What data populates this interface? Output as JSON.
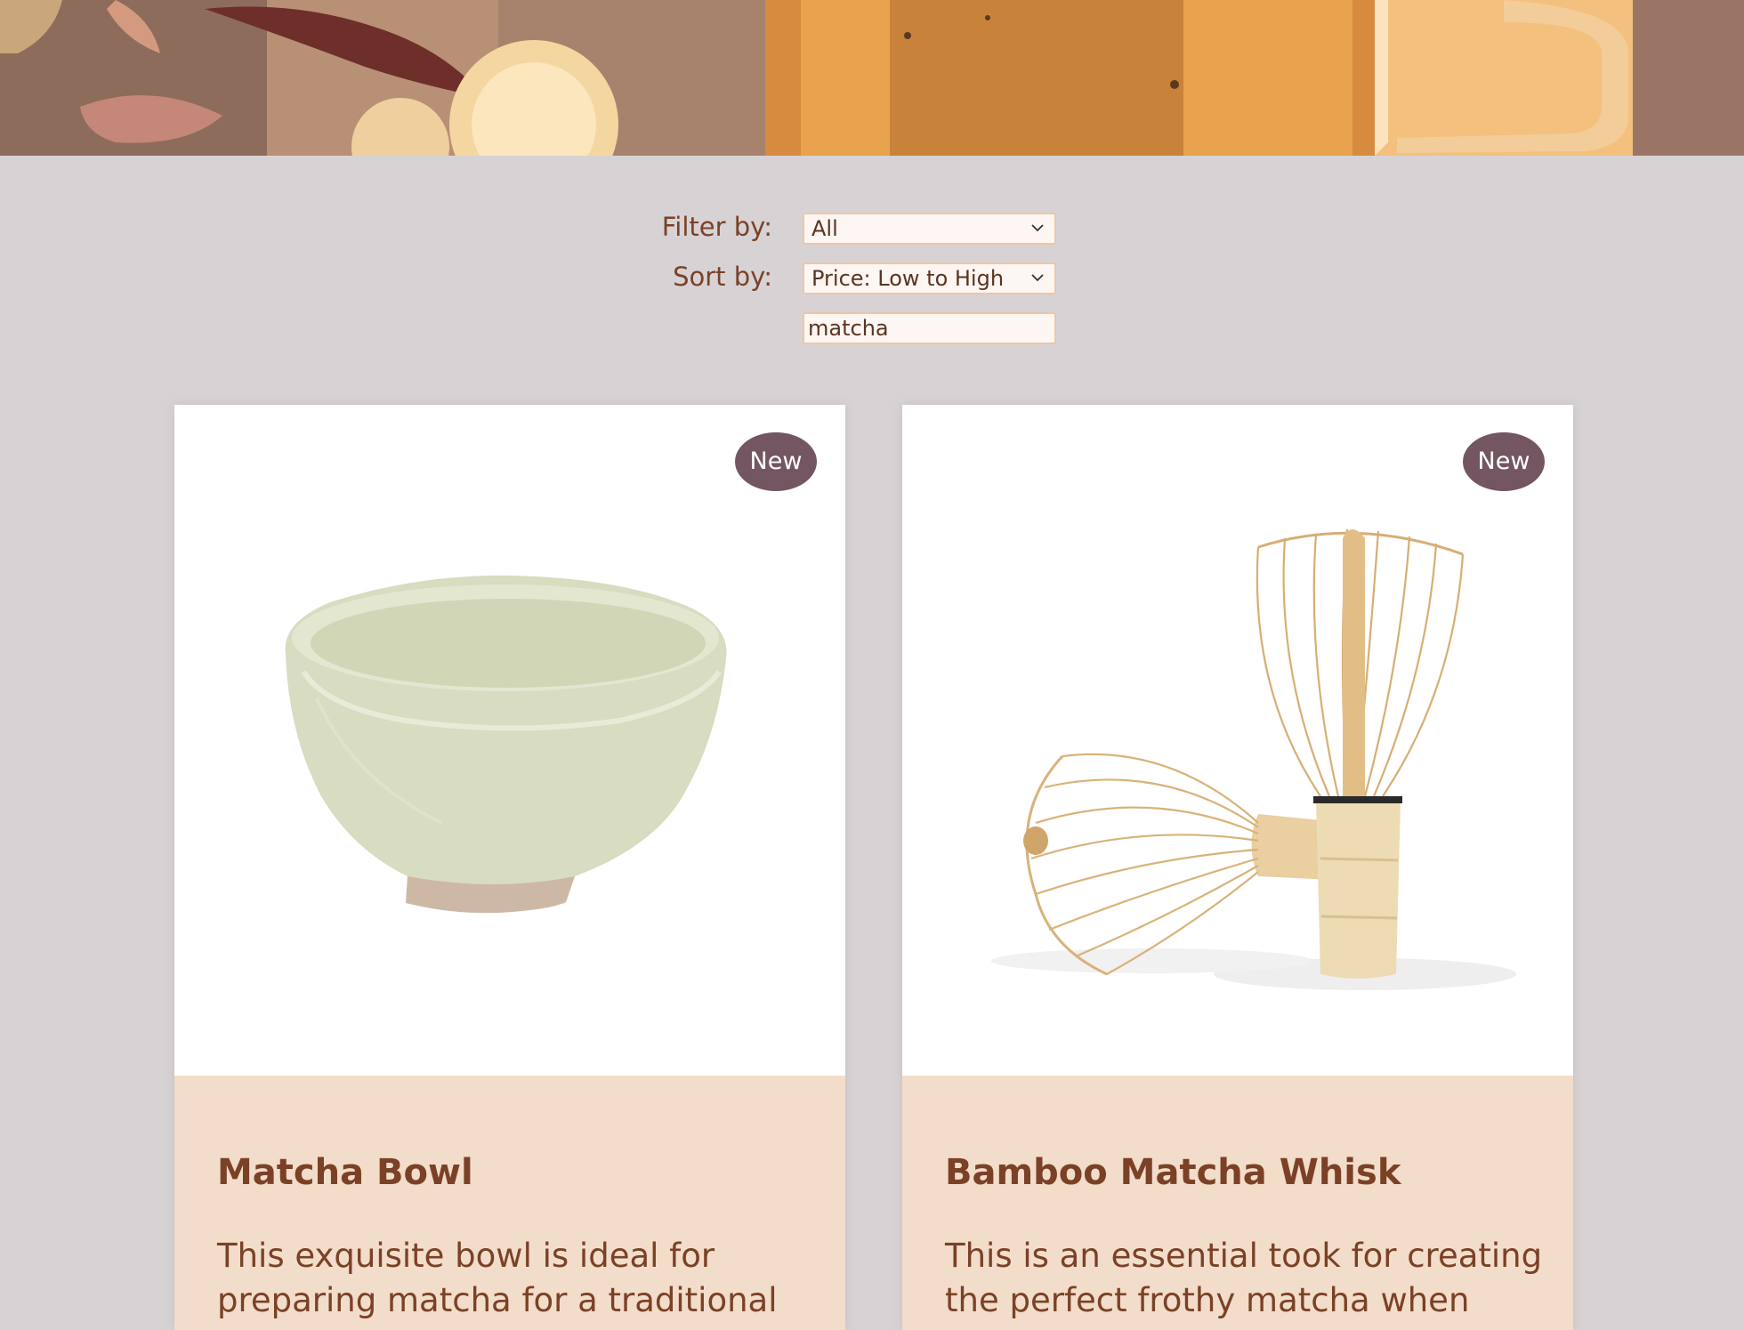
{
  "controls": {
    "filter_label": "Filter by:",
    "filter_value": "All",
    "sort_label": "Sort by:",
    "sort_value": "Price: Low to High",
    "search_value": "matcha"
  },
  "products": [
    {
      "badge": "New",
      "title": "Matcha Bowl",
      "description": "This exquisite bowl is ideal for preparing matcha for a traditional"
    },
    {
      "badge": "New",
      "title": "Bamboo Matcha Whisk",
      "description": "This is an essential took for creating the perfect frothy matcha when"
    }
  ],
  "colors": {
    "page_background": "#d7d3d5",
    "accent_text": "#7b4126",
    "badge_background": "#735661",
    "card_footer_background": "#f2ddca",
    "field_border": "#eec6a6"
  }
}
